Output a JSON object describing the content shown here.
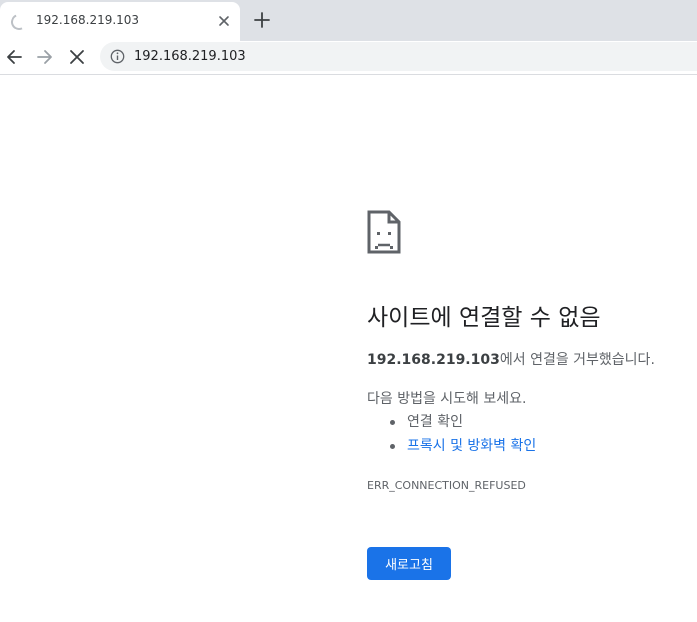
{
  "browser": {
    "tab": {
      "title": "192.168.219.103",
      "close_icon": "close-icon",
      "loading_icon": "spinner-icon"
    },
    "new_tab_icon": "plus-icon",
    "toolbar": {
      "back_icon": "arrow-left-icon",
      "forward_icon": "arrow-right-icon",
      "stop_icon": "close-icon",
      "url": "192.168.219.103",
      "info_icon": "info-icon"
    }
  },
  "error_page": {
    "icon": "sad-document-icon",
    "heading": "사이트에 연결할 수 없음",
    "host": "192.168.219.103",
    "message_suffix": "에서 연결을 거부했습니다.",
    "suggestion_intro": "다음 방법을 시도해 보세요.",
    "suggestions": [
      {
        "label": "연결 확인",
        "is_link": false
      },
      {
        "label": "프록시 및 방화벽 확인",
        "is_link": true
      }
    ],
    "error_code": "ERR_CONNECTION_REFUSED",
    "reload_label": "새로고침"
  },
  "colors": {
    "accent": "#1a73e8",
    "tabstrip": "#dee1e6",
    "omnibox": "#f1f3f4",
    "text": "#202124",
    "secondary_text": "#5f6368"
  }
}
